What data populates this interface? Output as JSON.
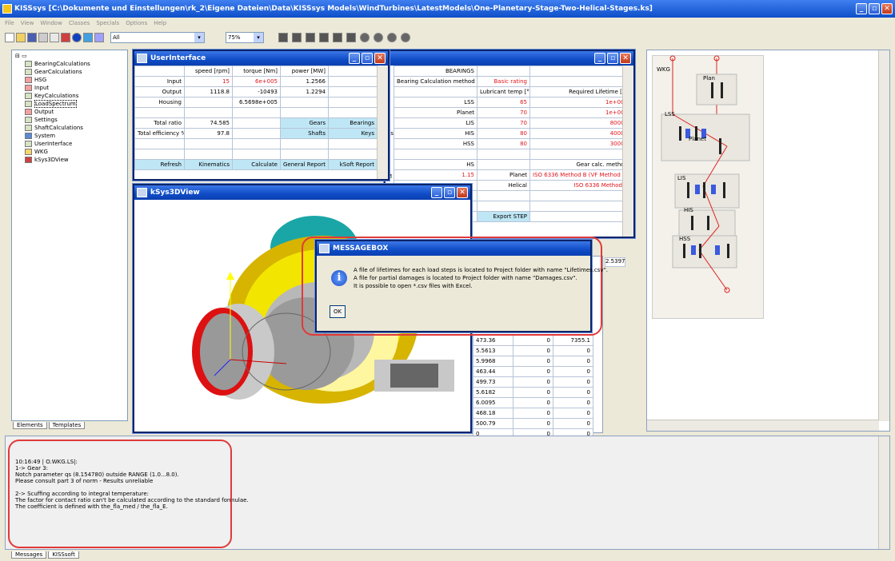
{
  "app": {
    "title": "KISSsys [C:\\Dokumente und Einstellungen\\rk_2\\Eigene Dateien\\Data\\KISSsys Models\\WindTurbines\\LatestModels\\One-Planetary-Stage-Two-Helical-Stages.ks]"
  },
  "menubar": [
    "File",
    "View",
    "Window",
    "Classes",
    "Specials",
    "Options",
    "Help"
  ],
  "toolbar": {
    "filter_value": "All",
    "zoom_value": "75%"
  },
  "tree": {
    "items": [
      "BearingCalculations",
      "GearCalculations",
      "HSG",
      "Input",
      "KeyCalculations",
      "LoadSpectrum",
      "Output",
      "Settings",
      "ShaftCalculations",
      "System",
      "UserInterface",
      "WKG",
      "kSys3DView"
    ],
    "tabs": [
      "Elements",
      "Templates"
    ]
  },
  "userinterface": {
    "title": "UserInterface",
    "headers": [
      "",
      "speed [rpm]",
      "torque [Nm]",
      "power [MW]",
      ""
    ],
    "rows": [
      [
        "Input",
        "15",
        "6e+005",
        "1.2566",
        ""
      ],
      [
        "Output",
        "1118.8",
        "-10493",
        "1.2294",
        ""
      ],
      [
        "Housing",
        "",
        "6.5698e+005",
        "",
        ""
      ],
      [
        "",
        "",
        "",
        "",
        ""
      ],
      [
        "Total ratio",
        "74.585",
        "",
        "Gears",
        "Bearings"
      ],
      [
        "Total efficiency %",
        "97.8",
        "",
        "Shafts",
        "Keys"
      ],
      [
        "",
        "",
        "",
        "",
        ""
      ],
      [
        "",
        "",
        "",
        "",
        ""
      ],
      [
        "Refresh",
        "Kinematics",
        "Calculate",
        "General Report",
        "kSoft Report"
      ]
    ]
  },
  "bearings": {
    "heading": "BEARINGS",
    "rows": [
      [
        "",
        "Bearing Calculation method",
        "Basic rating"
      ],
      [
        "",
        "Lubricant temp [°C]",
        "Required Lifetime [h]"
      ],
      [
        "LSS",
        "65",
        "1e+005"
      ],
      [
        "Planet",
        "70",
        "1e+005"
      ],
      [
        "LIS",
        "70",
        "80000"
      ],
      [
        "HIS",
        "80",
        "40000"
      ],
      [
        "HSS",
        "80",
        "30000"
      ],
      [
        "",
        "",
        ""
      ],
      [
        "HS",
        "",
        "Gear calc. method"
      ],
      [
        "1.15",
        "Planet",
        "ISO 6336 Method B (VF Method C)"
      ],
      [
        "",
        "Helical",
        "ISO 6336 Method B"
      ]
    ],
    "left_frag": [
      "as",
      "M",
      "25"
    ],
    "export_label": "Export STEP",
    "right_value": "2.5397"
  },
  "view3d": {
    "title": "kSys3DView"
  },
  "messagebox": {
    "title": "MESSAGEBOX",
    "line1": "A file of lifetimes for each load steps is located to Project folder with name \"Lifetimes.csv\".",
    "line2": "A file for partial damages is located to Project folder with name \"Damages.csv\".",
    "line3": "It is possible to open *.csv files with Excel.",
    "ok": "OK"
  },
  "lifetable": [
    [
      "473.36",
      "0",
      "7355.1"
    ],
    [
      "5.5613",
      "0",
      "0"
    ],
    [
      "5.9968",
      "0",
      "0"
    ],
    [
      "463.44",
      "0",
      "0"
    ],
    [
      "499.73",
      "0",
      "0"
    ],
    [
      "5.6182",
      "0",
      "0"
    ],
    [
      "6.0095",
      "0",
      "0"
    ],
    [
      "468.18",
      "0",
      "0"
    ],
    [
      "500.79",
      "0",
      "0"
    ],
    [
      "0",
      "0",
      "0"
    ]
  ],
  "schematic": {
    "labels": [
      "WKG",
      "Plan",
      "LSS",
      "Planet",
      "LIS",
      "HIS",
      "HSS"
    ]
  },
  "messages": {
    "lines": [
      "10:16:49 | O.WKG.LS|:",
      "1-> Gear 3:",
      "Notch parameter qs (8.154780) outside RANGE (1.0...8.0).",
      "Please consult part 3 of norm - Results unreliable",
      "",
      "2-> Scuffing according to integral temperature:",
      "The factor for contact ratio can't be calculated according to the standard formulae.",
      "The coefficient is defined with the_fla_med / the_fla_E."
    ],
    "tabs": [
      "Messages",
      "KISSsoft"
    ]
  },
  "colors": {
    "title_blue": "#0f4cc6",
    "highlight_red": "#e0161c",
    "cyan": "#bfe6f5"
  }
}
